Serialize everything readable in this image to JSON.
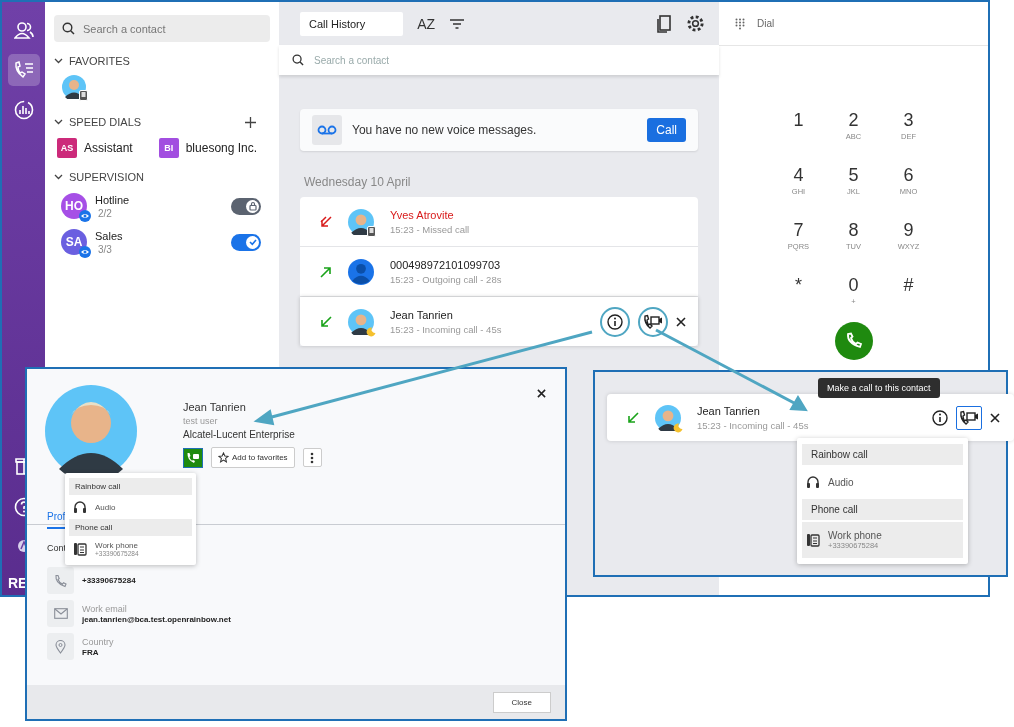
{
  "rail": {
    "items": [
      {
        "kind": "contacts",
        "selected": false
      },
      {
        "kind": "calls",
        "selected": true
      },
      {
        "kind": "stats",
        "selected": false
      }
    ],
    "logo_text": "RE"
  },
  "contacts_panel": {
    "search": {
      "placeholder": "Search a contact"
    },
    "favorites": {
      "title": "FAVORITES"
    },
    "speed_dials": {
      "title": "SPEED DIALS",
      "items": [
        {
          "initials": "AS",
          "name": "Assistant",
          "color": "#cc2a7a"
        },
        {
          "initials": "BI",
          "name": "bluesong Inc.",
          "color": "#a24ee0"
        }
      ]
    },
    "supervision": {
      "title": "SUPERVISION",
      "groups": [
        {
          "initials": "HO",
          "name": "Hotline",
          "count": "2/2",
          "color": "#a64fe6",
          "kind": "locked",
          "on": true
        },
        {
          "initials": "SA",
          "name": "Sales",
          "count": "3/3",
          "color": "#6a5fe0",
          "kind": "active",
          "on": true
        }
      ]
    }
  },
  "history": {
    "view": "Call History",
    "sort_button": "AZ",
    "search": {
      "placeholder": "Search a contact"
    },
    "voicemail": {
      "text": "You have no new voice messages.",
      "button": "Call"
    },
    "date": "Wednesday 10 April",
    "calls": [
      {
        "name": "Yves Atrovite",
        "detail": "15:23 - Missed call",
        "kind": "missed",
        "hovered": false
      },
      {
        "name": "000498972101099703",
        "detail": "15:23 - Outgoing call - 28s",
        "kind": "outgoing",
        "hovered": false
      },
      {
        "name": "Jean Tanrien",
        "detail": "15:23 - Incoming call - 45s",
        "kind": "incoming",
        "hovered": true
      }
    ]
  },
  "dialpad": {
    "title": "Dial",
    "keys": [
      {
        "digit": "1"
      },
      {
        "digit": "2",
        "letters": "ABC"
      },
      {
        "digit": "3",
        "letters": "DEF"
      },
      {
        "digit": "4",
        "letters": "GHI"
      },
      {
        "digit": "5",
        "letters": "JKL"
      },
      {
        "digit": "6",
        "letters": "MNO"
      },
      {
        "digit": "7",
        "letters": "PQRS"
      },
      {
        "digit": "8",
        "letters": "TUV"
      },
      {
        "digit": "9",
        "letters": "WXYZ"
      },
      {
        "digit": "*"
      },
      {
        "digit": "0",
        "letters": "+"
      },
      {
        "digit": "#"
      }
    ]
  },
  "contact_card": {
    "name": "Jean Tanrien",
    "role": "test user",
    "company": "Alcatel-Lucent Enterprise",
    "favorite_button": "Add to favorites",
    "tab": "Prof",
    "section": "Cont",
    "menu": [
      {
        "kind": "header",
        "label": "Rainbow call"
      },
      {
        "kind": "option",
        "label": "Audio",
        "selected": false
      },
      {
        "kind": "header",
        "label": "Phone call"
      },
      {
        "kind": "option",
        "label": "Work phone",
        "number": "+33390675284",
        "selected": false
      }
    ],
    "fields": [
      {
        "kind": "phone",
        "value": "+33390675284"
      },
      {
        "kind": "email",
        "label": "Work email",
        "value": "jean.tanrien@bca.test.openrainbow.net"
      },
      {
        "kind": "location",
        "label": "Country",
        "value": "FRA"
      }
    ],
    "close_button": "Close"
  },
  "call_detail": {
    "tooltip": "Make a call to this contact",
    "call": {
      "name": "Jean Tanrien",
      "detail": "15:23 - Incoming call - 45s",
      "kind": "incoming"
    },
    "menu": [
      {
        "kind": "header",
        "label": "Rainbow call"
      },
      {
        "kind": "option",
        "label": "Audio",
        "selected": false
      },
      {
        "kind": "header",
        "label": "Phone call"
      },
      {
        "kind": "option",
        "label": "Work phone",
        "number": "+33390675284",
        "selected": true
      }
    ]
  }
}
